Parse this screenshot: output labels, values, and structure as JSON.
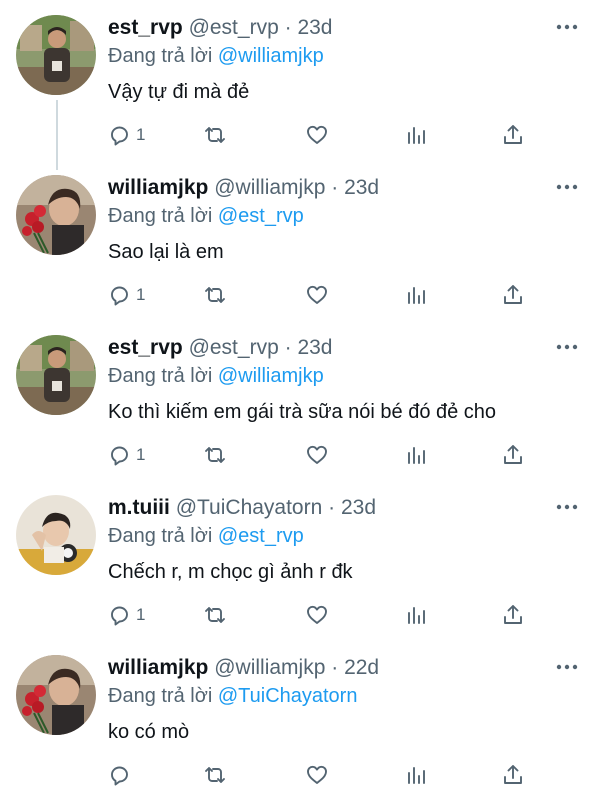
{
  "reply_prefix": "Đang trả lời",
  "tweets": [
    {
      "name": "est_rvp",
      "handle": "@est_rvp",
      "dot": "·",
      "time": "23d",
      "reply_to": "@williamjkp",
      "text": "Vậy tự đi mà đẻ",
      "reply_count": "1",
      "avatar": "man-standing-avatar"
    },
    {
      "name": "williamjkp",
      "handle": "@williamjkp",
      "dot": "·",
      "time": "23d",
      "reply_to": "@est_rvp",
      "text": "Sao lại là em",
      "reply_count": "1",
      "avatar": "man-with-roses-avatar"
    },
    {
      "name": "est_rvp",
      "handle": "@est_rvp",
      "dot": "·",
      "time": "23d",
      "reply_to": "@williamjkp",
      "text": "Ko thì kiếm em gái trà sữa nói bé đó đẻ cho",
      "reply_count": "1",
      "avatar": "man-standing-avatar"
    },
    {
      "name": "m.tuiii",
      "handle": "@TuiChayatorn",
      "dot": "·",
      "time": "23d",
      "reply_to": "@est_rvp",
      "text": "Chếch r, m chọc gì ảnh r đk",
      "reply_count": "1",
      "avatar": "person-with-headphones-avatar"
    },
    {
      "name": "williamjkp",
      "handle": "@williamjkp",
      "dot": "·",
      "time": "22d",
      "reply_to": "@TuiChayatorn",
      "text": "ko có mò",
      "reply_count": "",
      "avatar": "man-with-roses-avatar"
    }
  ],
  "colors": {
    "text": "#0f1419",
    "secondary": "#536471",
    "link": "#1d9bf0",
    "thread": "#cfd9de"
  }
}
